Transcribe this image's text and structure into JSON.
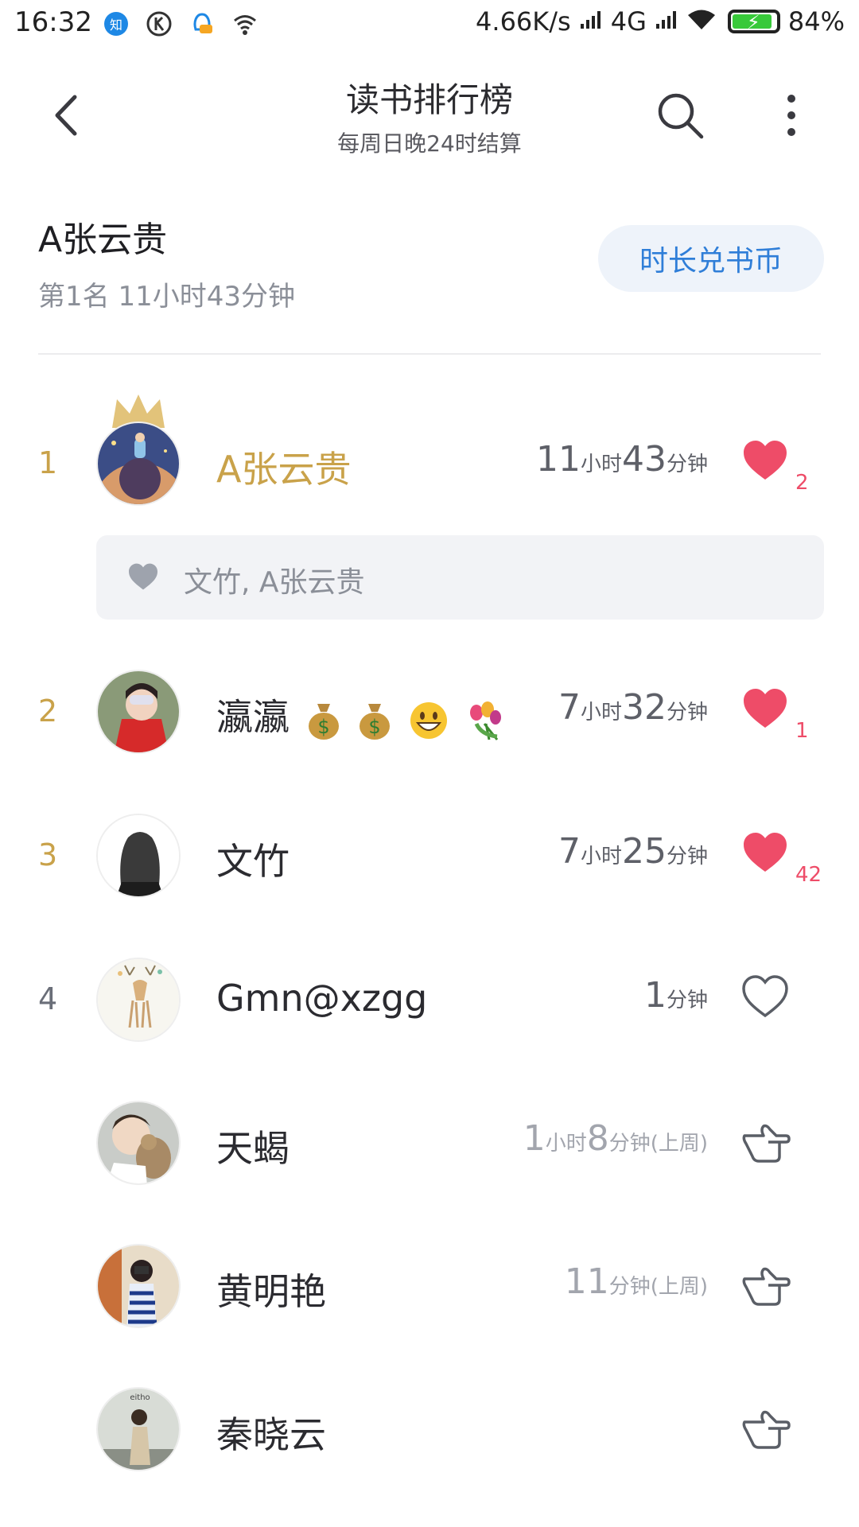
{
  "status_bar": {
    "time": "16:32",
    "speed": "4.66K/s",
    "network": "4G",
    "battery": "84%"
  },
  "header": {
    "title": "读书排行榜",
    "subtitle": "每周日晚24时结算"
  },
  "me": {
    "name": "A张云贵",
    "rank_text": "第1名 11小时43分钟",
    "exchange_label": "时长兑书币"
  },
  "likers_text": "文竹, A张云贵",
  "rows": [
    {
      "rank": "1",
      "name": "A张云贵",
      "h": "11",
      "h_unit": "小时",
      "m": "43",
      "m_unit": "分钟",
      "likes": "2"
    },
    {
      "rank": "2",
      "name": "瀛瀛",
      "h": "7",
      "h_unit": "小时",
      "m": "32",
      "m_unit": "分钟",
      "likes": "1"
    },
    {
      "rank": "3",
      "name": "文竹",
      "h": "7",
      "h_unit": "小时",
      "m": "25",
      "m_unit": "分钟",
      "likes": "42"
    },
    {
      "rank": "4",
      "name": "Gmn@xzgg",
      "m": "1",
      "m_unit": "分钟"
    },
    {
      "name": "天蝎",
      "h": "1",
      "h_unit": "小时",
      "m": "8",
      "m_unit": "分钟(上周)"
    },
    {
      "name": "黄明艳",
      "m": "11",
      "m_unit": "分钟(上周)"
    },
    {
      "name": "秦晓云"
    }
  ],
  "colors": {
    "gold": "#c9a24a",
    "like_red": "#ee4c68",
    "accent_blue": "#2f7ed8"
  }
}
